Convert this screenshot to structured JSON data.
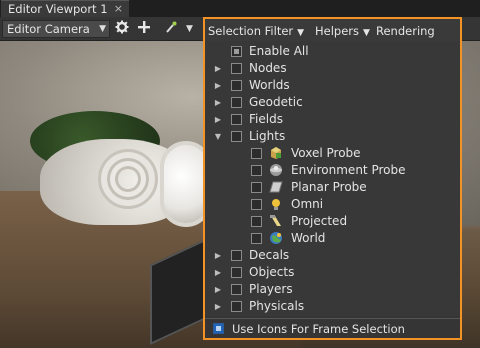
{
  "tab": {
    "title": "Editor Viewport 1",
    "close": "×"
  },
  "toolbar": {
    "camera": "Editor Camera",
    "menus": {
      "selection_filter": "Selection Filter",
      "helpers": "Helpers",
      "rendering_debug": "Rendering Debug"
    },
    "icons": [
      "gear-icon",
      "plus-icon",
      "wand-icon"
    ]
  },
  "dropdown": {
    "items": [
      {
        "label": "Enable All",
        "expander": "",
        "checked": "partial",
        "icon": ""
      },
      {
        "label": "Nodes",
        "expander": "▶",
        "checked": false,
        "icon": ""
      },
      {
        "label": "Worlds",
        "expander": "▶",
        "checked": false,
        "icon": ""
      },
      {
        "label": "Geodetic",
        "expander": "▶",
        "checked": false,
        "icon": ""
      },
      {
        "label": "Fields",
        "expander": "▶",
        "checked": false,
        "icon": ""
      },
      {
        "label": "Lights",
        "expander": "▼",
        "checked": false,
        "icon": ""
      },
      {
        "label": "Voxel Probe",
        "expander": "",
        "checked": false,
        "icon": "voxel-probe-icon"
      },
      {
        "label": "Environment Probe",
        "expander": "",
        "checked": false,
        "icon": "environment-probe-icon"
      },
      {
        "label": "Planar Probe",
        "expander": "",
        "checked": false,
        "icon": "planar-probe-icon"
      },
      {
        "label": "Omni",
        "expander": "",
        "checked": false,
        "icon": "omni-light-icon"
      },
      {
        "label": "Projected",
        "expander": "",
        "checked": false,
        "icon": "projected-light-icon"
      },
      {
        "label": "World",
        "expander": "",
        "checked": false,
        "icon": "world-light-icon"
      },
      {
        "label": "Decals",
        "expander": "▶",
        "checked": false,
        "icon": ""
      },
      {
        "label": "Objects",
        "expander": "▶",
        "checked": false,
        "icon": ""
      },
      {
        "label": "Players",
        "expander": "▶",
        "checked": false,
        "icon": ""
      },
      {
        "label": "Physicals",
        "expander": "▶",
        "checked": false,
        "icon": ""
      }
    ],
    "footer": {
      "label": "Use Icons For Frame Selection",
      "checked": true
    }
  },
  "colors": {
    "accent": "#f39325",
    "checkbox_on": "#1f64b6"
  }
}
